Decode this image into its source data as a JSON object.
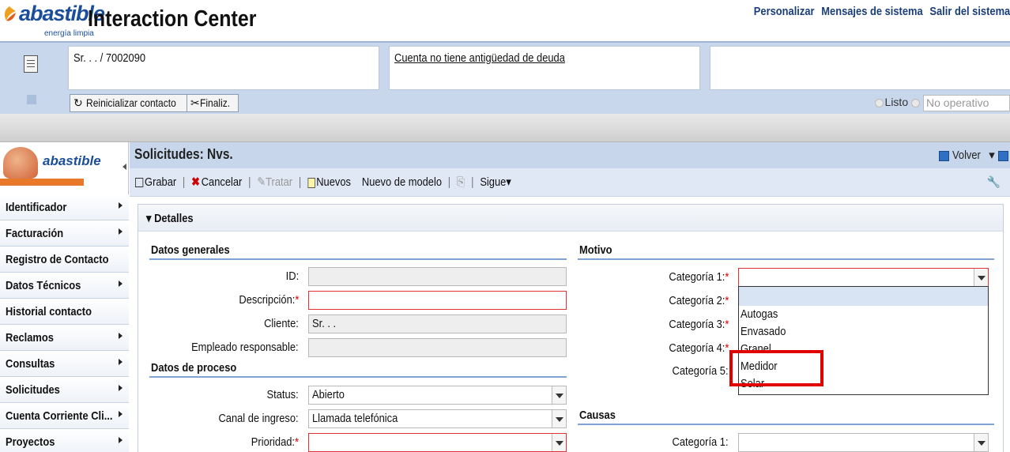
{
  "header": {
    "logo_text": "abastible",
    "logo_sub": "energía limpia",
    "title": "Interaction Center",
    "links": [
      "Personalizar",
      "Mensajes de sistema",
      "Salir del sistema"
    ]
  },
  "contact": {
    "name": "Sr. . . / 7002090",
    "debt_link": "Cuenta no tiene antigüedad de deuda",
    "reset_button": "Reinicializar contacto",
    "finish_button": "Finaliz.",
    "status_ready": "Listo",
    "status_select": "No operativo"
  },
  "sidebar": {
    "brand": "abastible",
    "items": [
      {
        "label": "Identificador",
        "arrow": true
      },
      {
        "label": "Facturación",
        "arrow": true
      },
      {
        "label": "Registro de Contacto",
        "arrow": false
      },
      {
        "label": "Datos Técnicos",
        "arrow": true
      },
      {
        "label": "Historial contacto",
        "arrow": false
      },
      {
        "label": "Reclamos",
        "arrow": true
      },
      {
        "label": "Consultas",
        "arrow": true
      },
      {
        "label": "Solicitudes",
        "arrow": true
      },
      {
        "label": "Cuenta Corriente Cli...",
        "arrow": true
      },
      {
        "label": "Proyectos",
        "arrow": true
      }
    ]
  },
  "main": {
    "title": "Solicitudes: Nvs.",
    "volver": "Volver",
    "toolbar": {
      "grabar": "Grabar",
      "cancelar": "Cancelar",
      "tratar": "Tratar",
      "nuevos": "Nuevos",
      "nuevo_modelo": "Nuevo de modelo",
      "sigue": "Sigue"
    },
    "panel_title": "Detalles"
  },
  "datos_generales": {
    "title": "Datos generales",
    "id_label": "ID:",
    "id_value": "",
    "descripcion_label": "Descripción:",
    "cliente_label": "Cliente:",
    "cliente_value": "Sr. . .",
    "empleado_label": "Empleado responsable:"
  },
  "datos_proceso": {
    "title": "Datos de proceso",
    "status_label": "Status:",
    "status_value": "Abierto",
    "canal_label": "Canal de ingreso:",
    "canal_value": "Llamada telefónica",
    "prioridad_label": "Prioridad:"
  },
  "motivo": {
    "title": "Motivo",
    "cat1": "Categoría 1:",
    "cat2": "Categoría 2:",
    "cat3": "Categoría 3:",
    "cat4": "Categoría 4:",
    "cat5": "Categoría 5:",
    "options": [
      "Autogas",
      "Envasado",
      "Granel",
      "Medidor",
      "Solar"
    ]
  },
  "causas": {
    "title": "Causas",
    "cat1": "Categoría 1:"
  },
  "colors": {
    "accent": "#1a4e9b",
    "band": "#c8d7eb",
    "highlight": "#e00000"
  }
}
